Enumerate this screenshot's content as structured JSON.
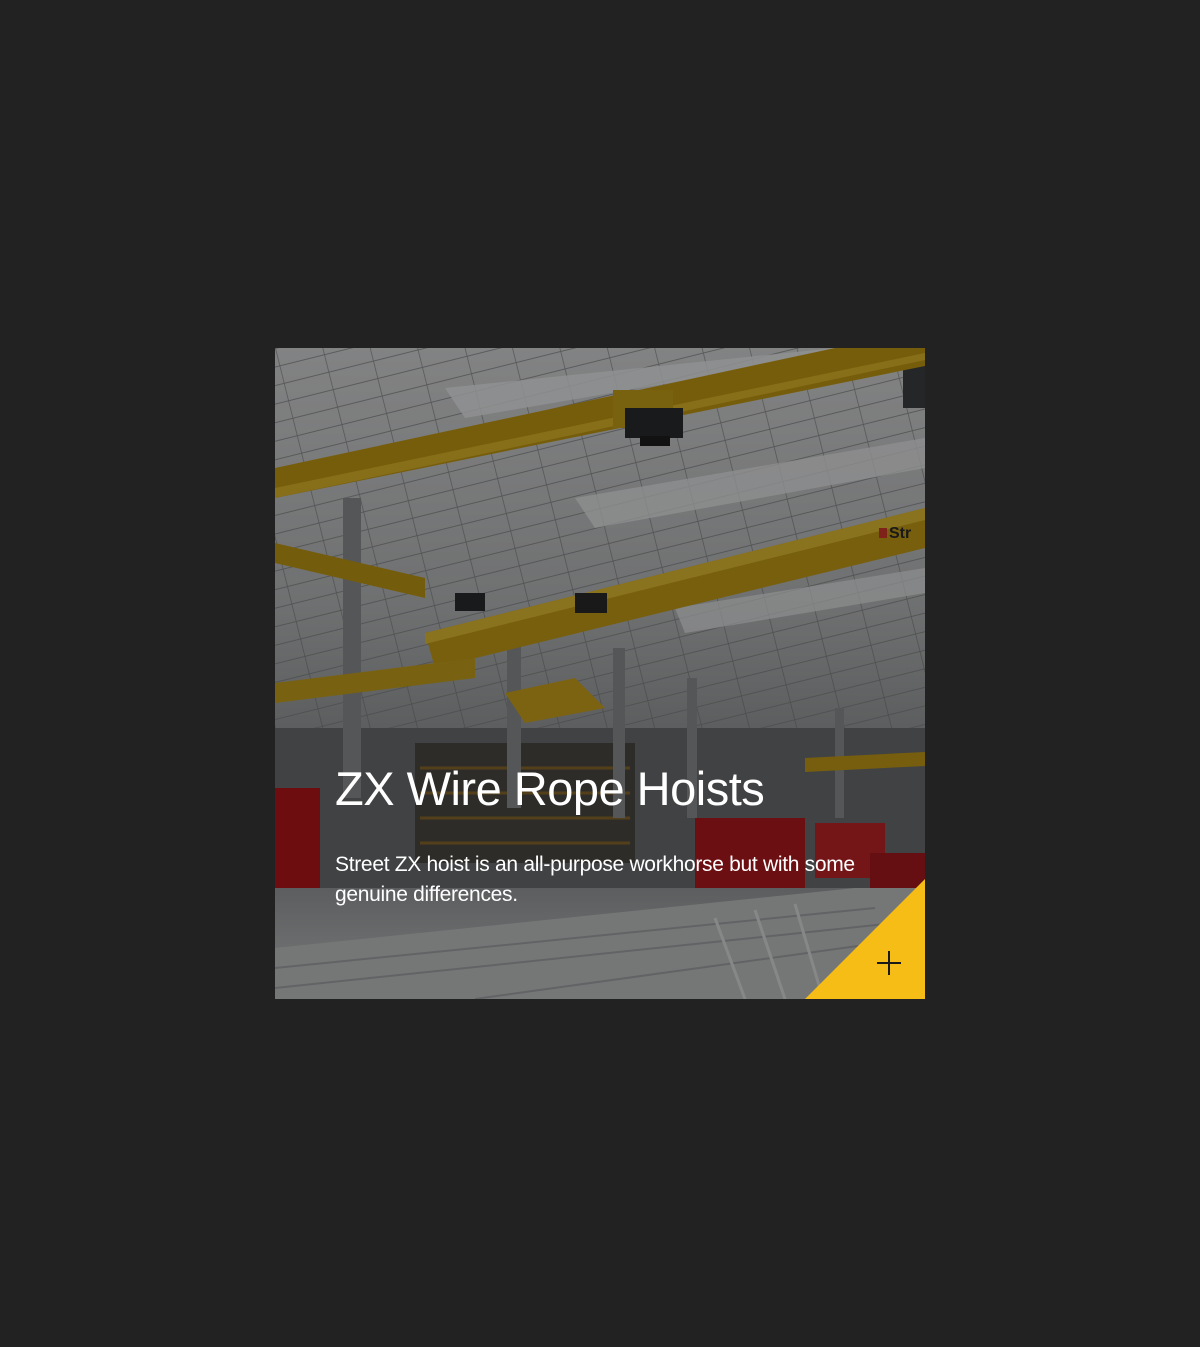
{
  "card": {
    "title": "ZX Wire Rope Hoists",
    "description": "Street ZX hoist is an all-purpose workhorse but with some genuine differences.",
    "beam_logo_text": "Str",
    "expand_icon": "plus-icon",
    "image_subject": "factory-hall-overhead-cranes"
  },
  "colors": {
    "page_background": "#222222",
    "accent_yellow": "#f6bd16",
    "crane_yellow": "#c9a21a",
    "text": "#ffffff"
  }
}
